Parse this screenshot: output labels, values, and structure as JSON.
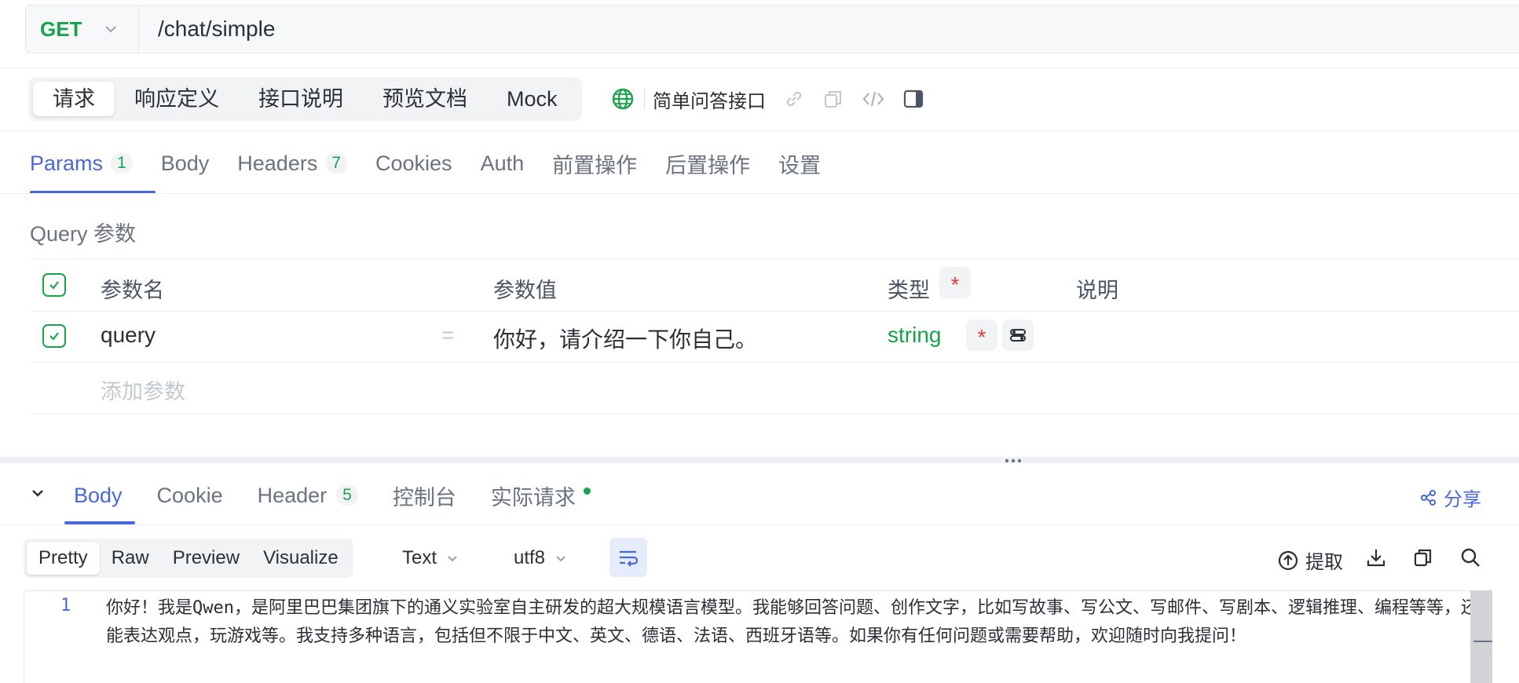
{
  "request": {
    "method": "GET",
    "url": "/chat/simple"
  },
  "main_tabs": [
    {
      "label": "请求",
      "active": true
    },
    {
      "label": "响应定义",
      "active": false
    },
    {
      "label": "接口说明",
      "active": false
    },
    {
      "label": "预览文档",
      "active": false
    },
    {
      "label": "Mock",
      "active": false
    }
  ],
  "endpoint_name": "简单问答接口",
  "param_tabs": {
    "params": "Params",
    "params_count": "1",
    "body": "Body",
    "headers": "Headers",
    "headers_count": "7",
    "cookies": "Cookies",
    "auth": "Auth",
    "pre": "前置操作",
    "post": "后置操作",
    "settings": "设置"
  },
  "query_section_label": "Query 参数",
  "table": {
    "headers": {
      "name": "参数名",
      "value": "参数值",
      "type": "类型",
      "required_mark": "*",
      "desc": "说明"
    },
    "rows": [
      {
        "name": "query",
        "eq": "=",
        "value": "你好，请介绍一下你自己。",
        "type": "string",
        "required_mark": "*"
      }
    ],
    "add_placeholder": "添加参数"
  },
  "response_tabs": {
    "body": "Body",
    "cookie": "Cookie",
    "header": "Header",
    "header_count": "5",
    "console": "控制台",
    "actual": "实际请求",
    "share": "分享"
  },
  "format_tabs": [
    {
      "label": "Pretty",
      "active": true
    },
    {
      "label": "Raw",
      "active": false
    },
    {
      "label": "Preview",
      "active": false
    },
    {
      "label": "Visualize",
      "active": false
    }
  ],
  "format_select": "Text",
  "encoding_select": "utf8",
  "extract_label": "提取",
  "response_body": {
    "line_number": "1",
    "text": "你好！我是Qwen，是阿里巴巴集团旗下的通义实验室自主研发的超大规模语言模型。我能够回答问题、创作文字，比如写故事、写公文、写邮件、写剧本、逻辑推理、编程等等，还能表达观点，玩游戏等。我支持多种语言，包括但不限于中文、英文、德语、法语、西班牙语等。如果你有任何问题或需要帮助，欢迎随时向我提问！"
  },
  "colors": {
    "accent": "#4a68d8",
    "green": "#17a34a",
    "required": "#e53e3e"
  }
}
